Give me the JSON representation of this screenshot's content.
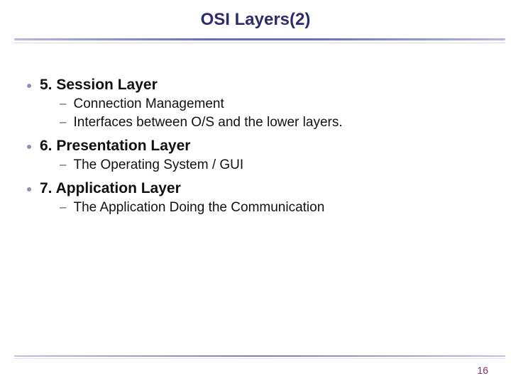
{
  "title": "OSI Layers(2)",
  "bullets": [
    {
      "label": "5. Session Layer",
      "subs": [
        "Connection Management",
        "Interfaces between O/S and the lower layers."
      ]
    },
    {
      "label": "6. Presentation Layer",
      "subs": [
        "The Operating System / GUI"
      ]
    },
    {
      "label": "7. Application Layer",
      "subs": [
        "The Application Doing the Communication"
      ]
    }
  ],
  "page_number": "16"
}
